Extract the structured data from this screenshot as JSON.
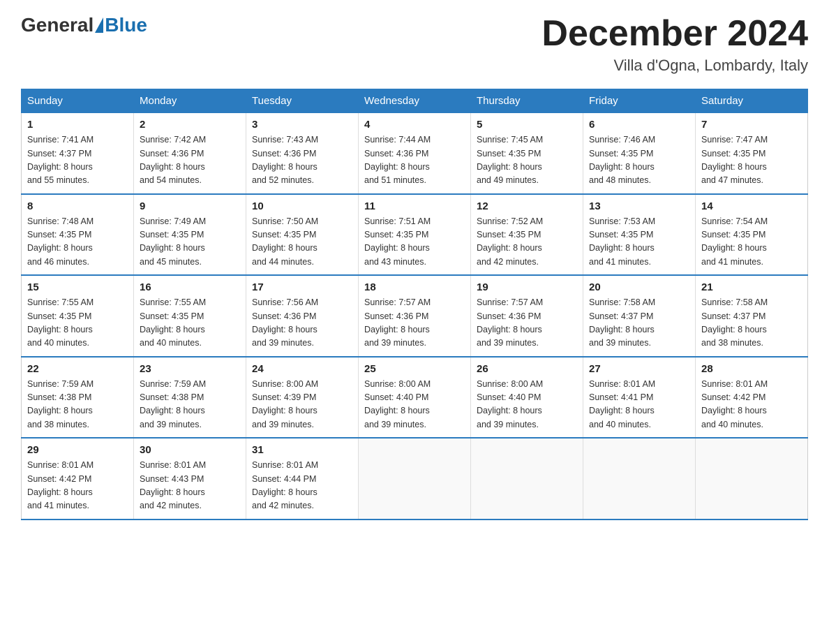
{
  "header": {
    "logo_general": "General",
    "logo_blue": "Blue",
    "month_title": "December 2024",
    "location": "Villa d'Ogna, Lombardy, Italy"
  },
  "days_of_week": [
    "Sunday",
    "Monday",
    "Tuesday",
    "Wednesday",
    "Thursday",
    "Friday",
    "Saturday"
  ],
  "weeks": [
    [
      {
        "day": "1",
        "sunrise": "7:41 AM",
        "sunset": "4:37 PM",
        "daylight": "8 hours and 55 minutes."
      },
      {
        "day": "2",
        "sunrise": "7:42 AM",
        "sunset": "4:36 PM",
        "daylight": "8 hours and 54 minutes."
      },
      {
        "day": "3",
        "sunrise": "7:43 AM",
        "sunset": "4:36 PM",
        "daylight": "8 hours and 52 minutes."
      },
      {
        "day": "4",
        "sunrise": "7:44 AM",
        "sunset": "4:36 PM",
        "daylight": "8 hours and 51 minutes."
      },
      {
        "day": "5",
        "sunrise": "7:45 AM",
        "sunset": "4:35 PM",
        "daylight": "8 hours and 49 minutes."
      },
      {
        "day": "6",
        "sunrise": "7:46 AM",
        "sunset": "4:35 PM",
        "daylight": "8 hours and 48 minutes."
      },
      {
        "day": "7",
        "sunrise": "7:47 AM",
        "sunset": "4:35 PM",
        "daylight": "8 hours and 47 minutes."
      }
    ],
    [
      {
        "day": "8",
        "sunrise": "7:48 AM",
        "sunset": "4:35 PM",
        "daylight": "8 hours and 46 minutes."
      },
      {
        "day": "9",
        "sunrise": "7:49 AM",
        "sunset": "4:35 PM",
        "daylight": "8 hours and 45 minutes."
      },
      {
        "day": "10",
        "sunrise": "7:50 AM",
        "sunset": "4:35 PM",
        "daylight": "8 hours and 44 minutes."
      },
      {
        "day": "11",
        "sunrise": "7:51 AM",
        "sunset": "4:35 PM",
        "daylight": "8 hours and 43 minutes."
      },
      {
        "day": "12",
        "sunrise": "7:52 AM",
        "sunset": "4:35 PM",
        "daylight": "8 hours and 42 minutes."
      },
      {
        "day": "13",
        "sunrise": "7:53 AM",
        "sunset": "4:35 PM",
        "daylight": "8 hours and 41 minutes."
      },
      {
        "day": "14",
        "sunrise": "7:54 AM",
        "sunset": "4:35 PM",
        "daylight": "8 hours and 41 minutes."
      }
    ],
    [
      {
        "day": "15",
        "sunrise": "7:55 AM",
        "sunset": "4:35 PM",
        "daylight": "8 hours and 40 minutes."
      },
      {
        "day": "16",
        "sunrise": "7:55 AM",
        "sunset": "4:35 PM",
        "daylight": "8 hours and 40 minutes."
      },
      {
        "day": "17",
        "sunrise": "7:56 AM",
        "sunset": "4:36 PM",
        "daylight": "8 hours and 39 minutes."
      },
      {
        "day": "18",
        "sunrise": "7:57 AM",
        "sunset": "4:36 PM",
        "daylight": "8 hours and 39 minutes."
      },
      {
        "day": "19",
        "sunrise": "7:57 AM",
        "sunset": "4:36 PM",
        "daylight": "8 hours and 39 minutes."
      },
      {
        "day": "20",
        "sunrise": "7:58 AM",
        "sunset": "4:37 PM",
        "daylight": "8 hours and 39 minutes."
      },
      {
        "day": "21",
        "sunrise": "7:58 AM",
        "sunset": "4:37 PM",
        "daylight": "8 hours and 38 minutes."
      }
    ],
    [
      {
        "day": "22",
        "sunrise": "7:59 AM",
        "sunset": "4:38 PM",
        "daylight": "8 hours and 38 minutes."
      },
      {
        "day": "23",
        "sunrise": "7:59 AM",
        "sunset": "4:38 PM",
        "daylight": "8 hours and 39 minutes."
      },
      {
        "day": "24",
        "sunrise": "8:00 AM",
        "sunset": "4:39 PM",
        "daylight": "8 hours and 39 minutes."
      },
      {
        "day": "25",
        "sunrise": "8:00 AM",
        "sunset": "4:40 PM",
        "daylight": "8 hours and 39 minutes."
      },
      {
        "day": "26",
        "sunrise": "8:00 AM",
        "sunset": "4:40 PM",
        "daylight": "8 hours and 39 minutes."
      },
      {
        "day": "27",
        "sunrise": "8:01 AM",
        "sunset": "4:41 PM",
        "daylight": "8 hours and 40 minutes."
      },
      {
        "day": "28",
        "sunrise": "8:01 AM",
        "sunset": "4:42 PM",
        "daylight": "8 hours and 40 minutes."
      }
    ],
    [
      {
        "day": "29",
        "sunrise": "8:01 AM",
        "sunset": "4:42 PM",
        "daylight": "8 hours and 41 minutes."
      },
      {
        "day": "30",
        "sunrise": "8:01 AM",
        "sunset": "4:43 PM",
        "daylight": "8 hours and 42 minutes."
      },
      {
        "day": "31",
        "sunrise": "8:01 AM",
        "sunset": "4:44 PM",
        "daylight": "8 hours and 42 minutes."
      },
      null,
      null,
      null,
      null
    ]
  ],
  "labels": {
    "sunrise": "Sunrise:",
    "sunset": "Sunset:",
    "daylight": "Daylight:"
  }
}
